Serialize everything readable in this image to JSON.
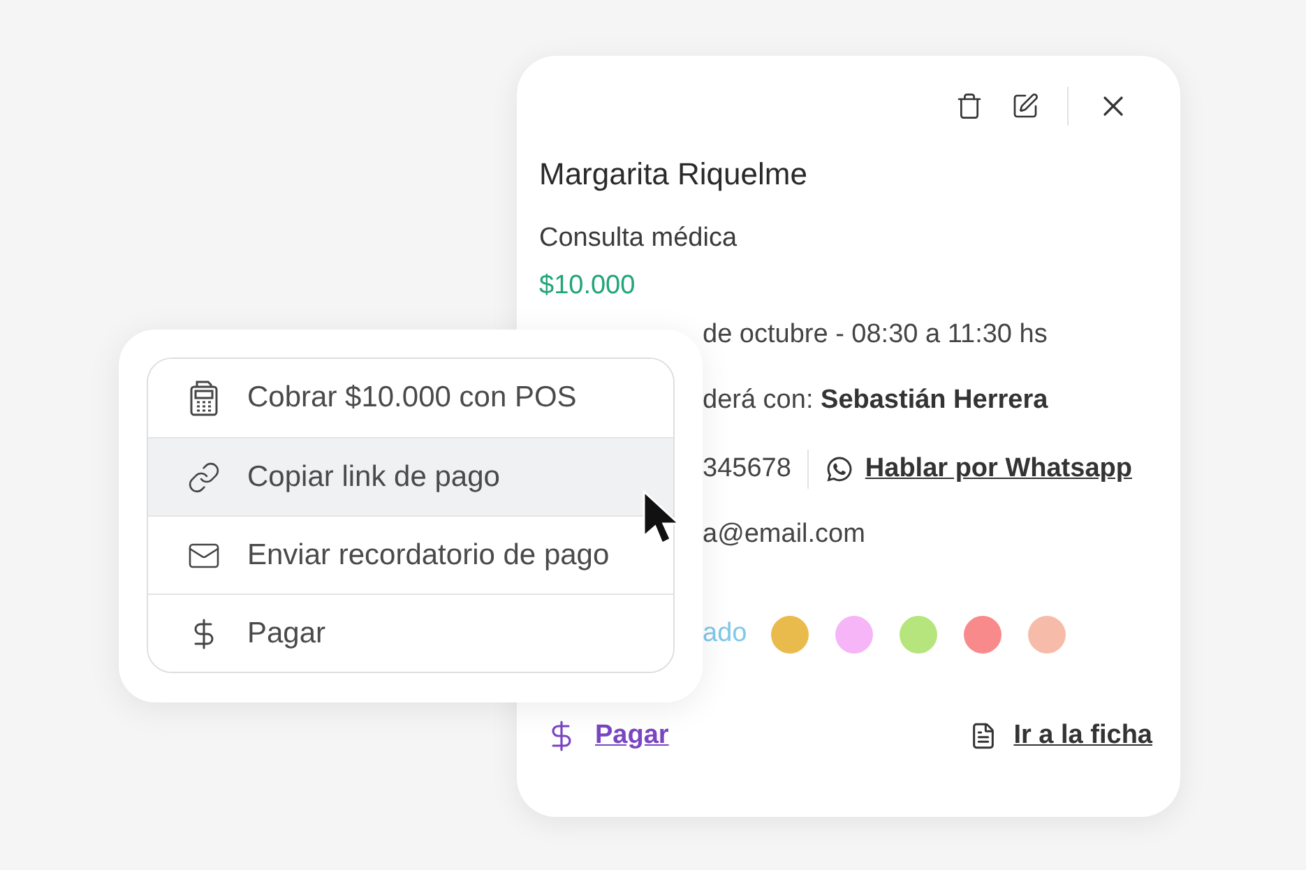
{
  "card": {
    "name": "Margarita Riquelme",
    "service": "Consulta médica",
    "price": "$10.000",
    "date": "de octubre - 08:30 a 11:30 hs",
    "professional": {
      "label": "derá con:",
      "name": "Sebastián Herrera"
    },
    "phone": "345678",
    "whatsapp_link": "Hablar por Whatsapp",
    "email": "a@email.com",
    "status": {
      "label": "ado",
      "colors": [
        {
          "color": "#e8bb4c"
        },
        {
          "color": "#f6b5f7"
        },
        {
          "color": "#b5e57c"
        },
        {
          "color": "#f98a8b"
        },
        {
          "color": "#f7bca9"
        }
      ]
    },
    "footer": {
      "pay_link": "Pagar",
      "record_link": "Ir a la ficha"
    }
  },
  "menu": {
    "items": [
      {
        "kind": "pos",
        "label": "Cobrar $10.000 con POS",
        "selected": false
      },
      {
        "kind": "link",
        "label": "Copiar link de pago",
        "selected": true
      },
      {
        "kind": "mail",
        "label": "Enviar recordatorio de pago",
        "selected": false
      },
      {
        "kind": "dollar",
        "label": "Pagar",
        "selected": false
      }
    ]
  }
}
